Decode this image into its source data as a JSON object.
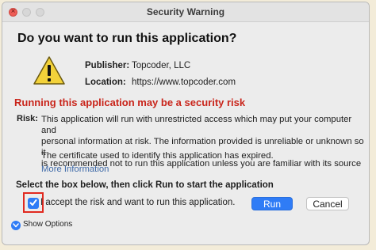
{
  "window": {
    "title": "Security Warning"
  },
  "dialog": {
    "heading": "Do you want to run this application?",
    "publisher_label": "Publisher:",
    "publisher_value": "Topcoder, LLC",
    "location_label": "Location:",
    "location_value": "https://www.topcoder.com",
    "risk_title": "Running this application may be a security risk",
    "risk_label": "Risk:",
    "risk_line1": "This application will run with unrestricted access which may put your computer and",
    "risk_line2": "personal information at risk. The information provided is unreliable or unknown so it",
    "risk_line3": "is recommended not to run this application unless you are familiar with its source",
    "certificate_text": "The certificate used to identify this application has expired.",
    "more_info_link": "More Information",
    "instruction": "Select the box below, then click Run to start the application",
    "accept_checkbox": {
      "checked": true,
      "label": "I accept the risk and want to run this application."
    },
    "run_button": "Run",
    "cancel_button": "Cancel",
    "show_options": "Show Options"
  },
  "icons": {
    "warning": "warning-triangle-icon",
    "checkbox": "checkmark-icon",
    "disclosure": "chevron-down-icon"
  },
  "colors": {
    "risk_title": "#c9251b",
    "accent_blue": "#2f7cf6",
    "link": "#3f6aa8",
    "highlight_box": "#e1291f",
    "warning_fill": "#f3d23a"
  }
}
